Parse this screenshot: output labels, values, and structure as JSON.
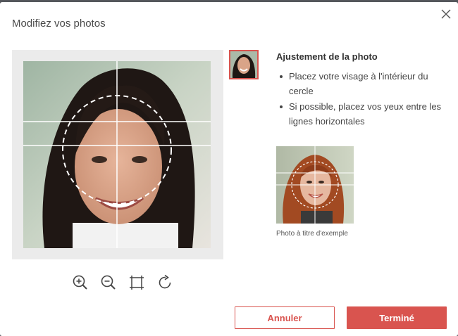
{
  "dialog": {
    "title": "Modifiez vos photos"
  },
  "editor": {
    "tools": [
      "zoom-in-icon",
      "zoom-out-icon",
      "fit-frame-icon",
      "rotate-icon"
    ]
  },
  "guidance": {
    "heading": "Ajustement de la photo",
    "tips": [
      "Placez votre visage à l'intérieur du cercle",
      "Si possible, placez vos yeux entre les lignes horizontales"
    ],
    "example_caption": "Photo à titre d'exemple"
  },
  "actions": {
    "cancel_label": "Annuler",
    "done_label": "Terminé"
  },
  "colors": {
    "accent": "#d9544f",
    "editor_bg": "#ebebeb"
  }
}
